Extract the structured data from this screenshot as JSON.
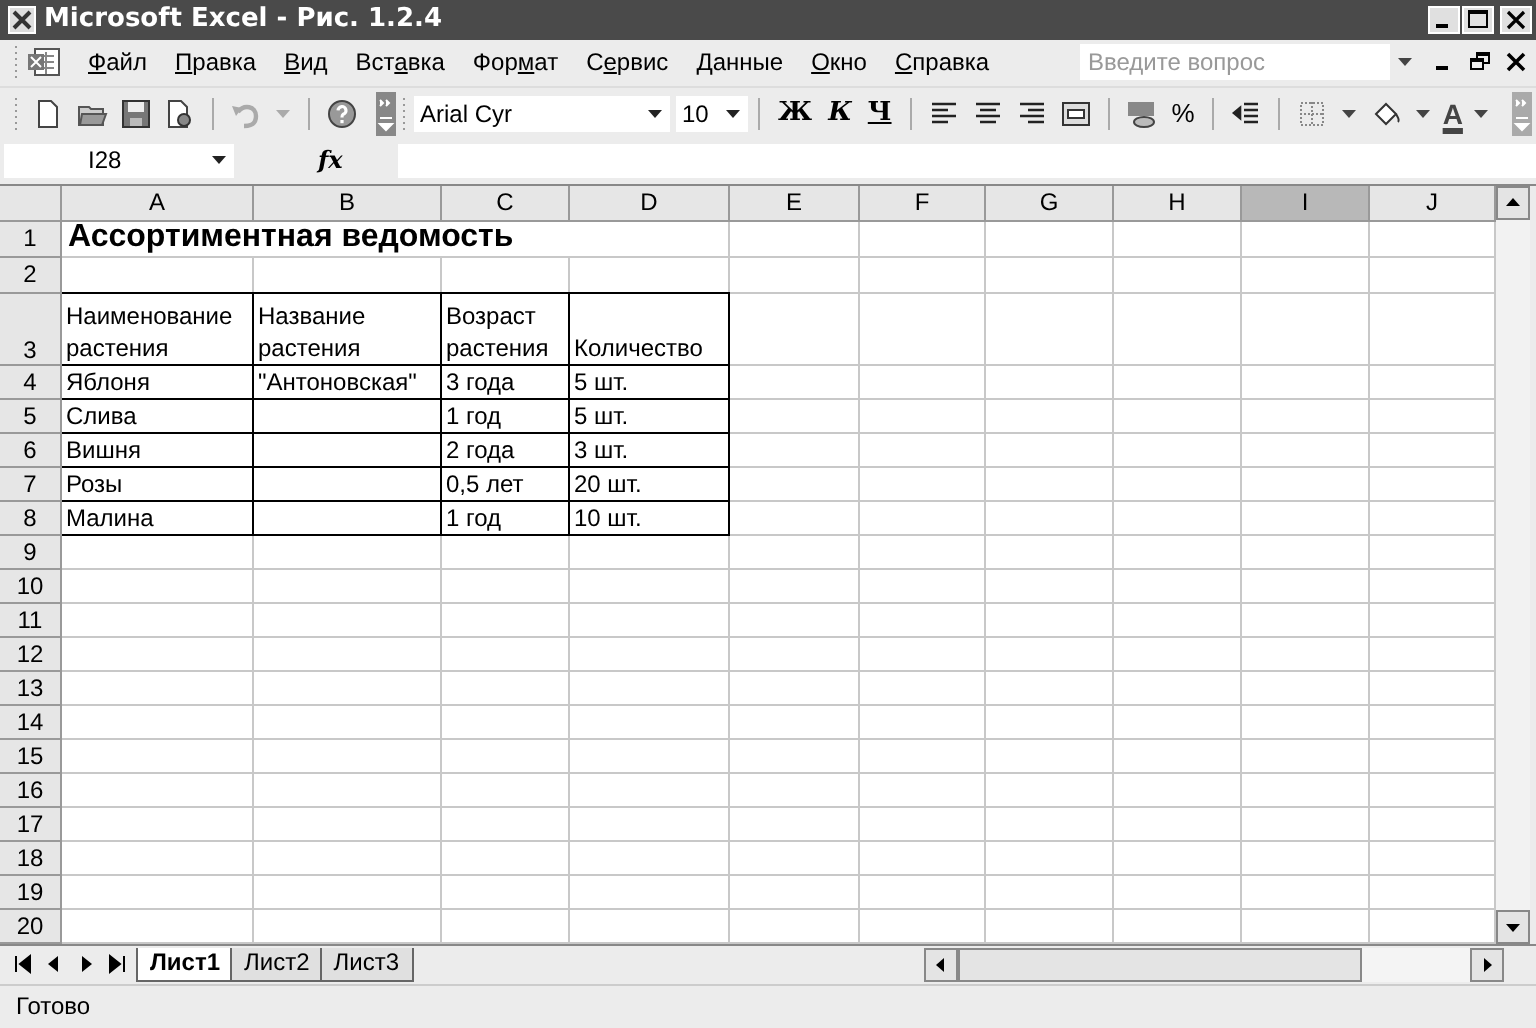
{
  "window": {
    "title": "Microsoft Excel - Рис. 1.2.4"
  },
  "menu": [
    {
      "label": "Файл"
    },
    {
      "label": "Правка"
    },
    {
      "label": "Вид"
    },
    {
      "label": "Вставка"
    },
    {
      "label": "Формат"
    },
    {
      "label": "Сервис"
    },
    {
      "label": "Данные"
    },
    {
      "label": "Окно"
    },
    {
      "label": "Справка"
    }
  ],
  "help_search": {
    "placeholder": "Введите вопрос"
  },
  "toolbar": {
    "font": "Arial Cyr",
    "size": "10",
    "format_buttons": [
      {
        "label": "Ж",
        "kind": "bold"
      },
      {
        "label": "К",
        "kind": "italic"
      },
      {
        "label": "Ч",
        "kind": "underline"
      }
    ],
    "percent": "%",
    "font_color": "A"
  },
  "formula_bar": {
    "name_box": "I28",
    "fx": "fx"
  },
  "columns": [
    {
      "label": "A",
      "selected": false
    },
    {
      "label": "B",
      "selected": false
    },
    {
      "label": "C",
      "selected": false
    },
    {
      "label": "D",
      "selected": false
    },
    {
      "label": "E",
      "selected": false
    },
    {
      "label": "F",
      "selected": false
    },
    {
      "label": "G",
      "selected": false
    },
    {
      "label": "H",
      "selected": false
    },
    {
      "label": "I",
      "selected": true
    },
    {
      "label": "J",
      "selected": false
    }
  ],
  "rows": [
    {
      "number": "1",
      "kind": "title",
      "bordered": false,
      "cells": {
        "a": "Ассортиментная ведомость"
      }
    },
    {
      "number": "2",
      "kind": "data",
      "bordered": false,
      "cells": {}
    },
    {
      "number": "3",
      "kind": "header",
      "bordered": true,
      "cells": {
        "a": "Наименование растения",
        "b": "Название растения",
        "c": "Возраст растения",
        "d": "Количество"
      }
    },
    {
      "number": "4",
      "kind": "data",
      "bordered": true,
      "cells": {
        "a": "Яблоня",
        "b": "\"Антоновская\"",
        "c": "3 года",
        "d": "5 шт."
      }
    },
    {
      "number": "5",
      "kind": "data",
      "bordered": true,
      "cells": {
        "a": "Слива",
        "c": "1 год",
        "d": "5 шт."
      }
    },
    {
      "number": "6",
      "kind": "data",
      "bordered": true,
      "cells": {
        "a": "Вишня",
        "c": "2 года",
        "d": "3 шт."
      }
    },
    {
      "number": "7",
      "kind": "data",
      "bordered": true,
      "cells": {
        "a": "Розы",
        "c": "0,5 лет",
        "d": "20 шт."
      }
    },
    {
      "number": "8",
      "kind": "data",
      "bordered": true,
      "cells": {
        "a": "Малина",
        "c": "1 год",
        "d": "10 шт."
      }
    },
    {
      "number": "9",
      "kind": "data",
      "bordered": false,
      "cells": {}
    },
    {
      "number": "10",
      "kind": "data",
      "bordered": false,
      "cells": {}
    },
    {
      "number": "11",
      "kind": "data",
      "bordered": false,
      "cells": {}
    },
    {
      "number": "12",
      "kind": "data",
      "bordered": false,
      "cells": {}
    },
    {
      "number": "13",
      "kind": "data",
      "bordered": false,
      "cells": {}
    },
    {
      "number": "14",
      "kind": "data",
      "bordered": false,
      "cells": {}
    },
    {
      "number": "15",
      "kind": "data",
      "bordered": false,
      "cells": {}
    },
    {
      "number": "16",
      "kind": "data",
      "bordered": false,
      "cells": {}
    },
    {
      "number": "17",
      "kind": "data",
      "bordered": false,
      "cells": {}
    },
    {
      "number": "18",
      "kind": "data",
      "bordered": false,
      "cells": {}
    },
    {
      "number": "19",
      "kind": "data",
      "bordered": false,
      "cells": {}
    },
    {
      "number": "20",
      "kind": "data",
      "bordered": false,
      "cells": {}
    }
  ],
  "sheet_tabs": [
    {
      "label": "Лист1",
      "selected": true
    },
    {
      "label": "Лист2",
      "selected": false
    },
    {
      "label": "Лист3",
      "selected": false
    }
  ],
  "status_bar": {
    "text": "Готово"
  }
}
